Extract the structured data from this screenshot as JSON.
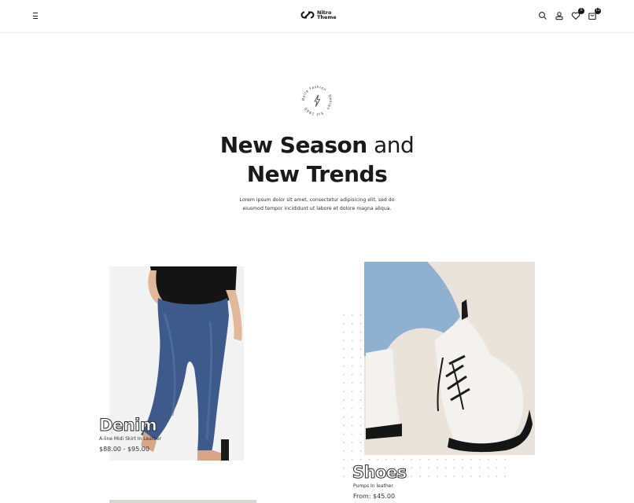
{
  "header": {
    "logo_line1": "Nitro",
    "logo_line2": "Theme",
    "wishlist_count": "0",
    "cart_count": "12",
    "icons": [
      "menu-icon",
      "search-icon",
      "account-icon",
      "wishlist-icon",
      "cart-icon"
    ]
  },
  "stamp": {
    "ring_text": "Belle Fashion · Design · Est 1960 ·",
    "icon": "lightning-icon"
  },
  "hero": {
    "title_bold_1": "New Season",
    "title_normal": " and",
    "title_bold_2": "New Trends",
    "description": "Lorem ipsum dolor sit amet, consectetur adipisicing elit, sed do eiusmod tempor incididunt ut labore et dolore magna aliqua."
  },
  "products": [
    {
      "name": "Denim",
      "subtitle": "A-line Midi Skirt In Leather",
      "price": "$88.00 - $95.00"
    },
    {
      "name": "Shoes",
      "subtitle": "Pumps In leather",
      "price": "From: $45.00"
    }
  ],
  "colors": {
    "text": "#1a1a1a",
    "denim_bg": "#f1f1f1",
    "shoes_bg": "#e8e2da"
  }
}
